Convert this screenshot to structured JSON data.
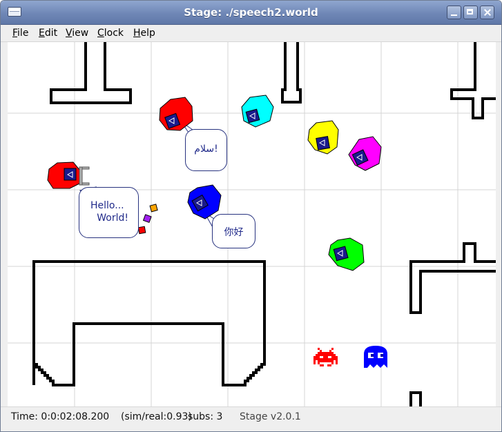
{
  "window": {
    "title": "Stage: ./speech2.world"
  },
  "menu": [
    {
      "id": "file",
      "acc": "F",
      "rest": "ile"
    },
    {
      "id": "edit",
      "acc": "E",
      "rest": "dit"
    },
    {
      "id": "view",
      "acc": "V",
      "rest": "iew"
    },
    {
      "id": "clock",
      "acc": "C",
      "rest": "lock"
    },
    {
      "id": "help",
      "acc": "H",
      "rest": "elp"
    }
  ],
  "speech": {
    "hello_line1": "Hello...",
    "hello_line2": "World!",
    "arabic": "سلام!",
    "chinese": "你好"
  },
  "robots": [
    {
      "name": "red-robot-with-gripper",
      "color": "#ff0000"
    },
    {
      "name": "red-robot-upper",
      "color": "#ff0000"
    },
    {
      "name": "cyan-robot",
      "color": "#00ffff"
    },
    {
      "name": "yellow-robot",
      "color": "#ffff00"
    },
    {
      "name": "magenta-robot",
      "color": "#ff00ff"
    },
    {
      "name": "blue-robot",
      "color": "#0000ff"
    },
    {
      "name": "green-robot",
      "color": "#00ff00"
    }
  ],
  "pucks": [
    {
      "name": "orange-puck",
      "color": "#ffa500"
    },
    {
      "name": "purple-puck",
      "color": "#a020f0"
    },
    {
      "name": "red-puck",
      "color": "#ff0000"
    }
  ],
  "sprites": [
    {
      "name": "red-invader-icon",
      "color": "#ff0000"
    },
    {
      "name": "blue-ghost-icon",
      "color": "#0000ff"
    }
  ],
  "status": {
    "time": "Time: 0:0:02:08.200",
    "ratio": "(sim/real:0.93)",
    "subs": "subs: 3",
    "version": "Stage v2.0.1"
  }
}
